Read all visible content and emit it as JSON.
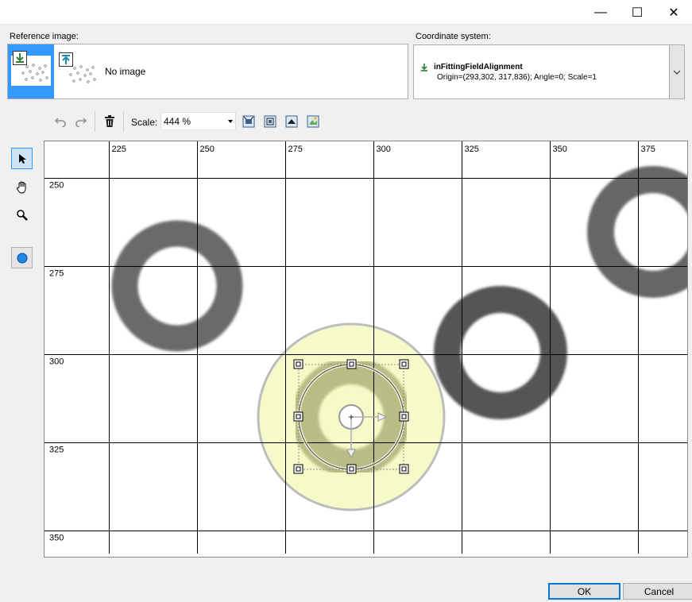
{
  "window": {
    "minimize_glyph": "—",
    "maximize_glyph": "☐",
    "close_glyph": "✕"
  },
  "reference": {
    "label": "Reference image:",
    "no_image_text": "No image"
  },
  "coord": {
    "label": "Coordinate system:",
    "name": "inFittingFieldAlignment",
    "detail": "Origin=(293,302, 317,836); Angle=0; Scale=1"
  },
  "toolbar": {
    "scale_label": "Scale:",
    "scale_value": "444 %"
  },
  "ruler": {
    "x_ticks": [
      "225",
      "250",
      "275",
      "300",
      "325",
      "350",
      "375"
    ],
    "y_ticks": [
      "250",
      "275",
      "300",
      "325",
      "350"
    ]
  },
  "buttons": {
    "ok": "OK",
    "cancel": "Cancel"
  },
  "colors": {
    "accent": "#3399ff",
    "selection_fill": "#f5fac8",
    "grid": "#000000"
  },
  "icons": [
    "undo-icon",
    "redo-icon",
    "delete-icon",
    "fit-icon",
    "zoom-100-icon",
    "fit-width-icon",
    "fit-height-icon",
    "pointer-icon",
    "hand-icon",
    "magnifier-icon",
    "circle-icon",
    "chevron-down-icon"
  ]
}
